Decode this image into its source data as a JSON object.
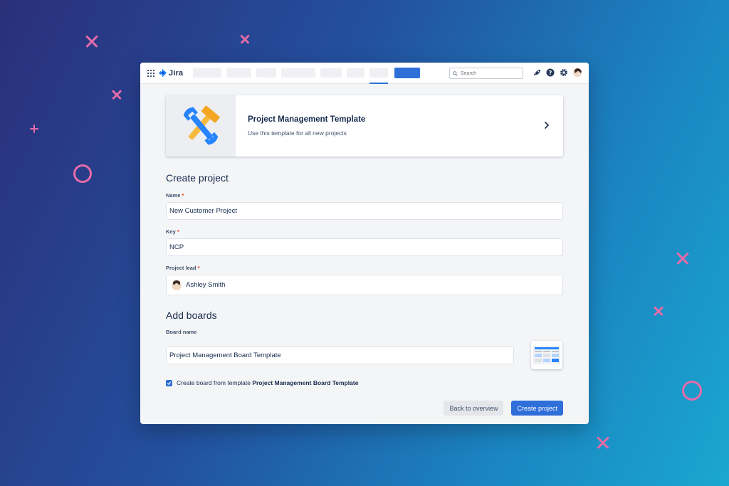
{
  "app": {
    "name": "Jira"
  },
  "search": {
    "placeholder": "Search"
  },
  "template": {
    "title": "Project Management Template",
    "subtitle": "Use this template for all new projects"
  },
  "create_project": {
    "heading": "Create project",
    "name_label": "Name",
    "name_value": "New Customer Project",
    "key_label": "Key",
    "key_value": "NCP",
    "lead_label": "Project lead",
    "lead_value": "Ashley Smith",
    "required_marker": "*"
  },
  "boards": {
    "heading": "Add boards",
    "board_name_label": "Board name",
    "board_name_value": "Project Management Board Template",
    "checkbox_text": "Create board from template",
    "checkbox_template": "Project Management Board Template",
    "checkbox_checked": true
  },
  "actions": {
    "back_label": "Back to overview",
    "create_label": "Create project"
  },
  "icons": {
    "app_switcher": "grid-icon",
    "logo": "jira-logo-icon",
    "notifications": "rocket-icon",
    "help": "help-icon",
    "settings": "gear-icon",
    "profile": "avatar",
    "template_art": "tools-icon",
    "chevron": "chevron-right-icon"
  },
  "colors": {
    "accent": "#2f6fd9",
    "decoration": "#e46ca8",
    "background_start": "#2b2f7a",
    "background_end": "#1aa7cf"
  }
}
